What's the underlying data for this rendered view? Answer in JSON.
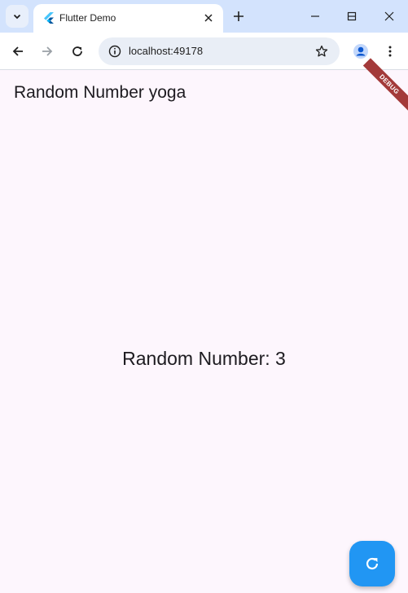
{
  "browser": {
    "tab": {
      "title": "Flutter Demo",
      "favicon": "flutter-icon"
    },
    "address_bar": {
      "url": "localhost:49178"
    },
    "icons": {
      "tab_search": "chevron-down-icon",
      "new_tab": "plus-icon",
      "minimize": "minimize-icon",
      "maximize": "maximize-icon",
      "close": "close-icon",
      "back": "back-arrow-icon",
      "forward": "forward-arrow-icon",
      "reload": "reload-icon",
      "site_info": "info-icon",
      "bookmark": "star-icon",
      "profile": "profile-icon",
      "menu": "more-vert-icon"
    }
  },
  "app": {
    "title": "Random Number yoga",
    "debug_banner": "DEBUG",
    "random_number_text": "Random Number: 3",
    "fab_icon": "refresh-icon"
  },
  "colors": {
    "tabstrip": "#d3e3fd",
    "app_background": "#fdf6fd",
    "fab": "#2196f3",
    "debug_banner": "#a33a3a"
  }
}
